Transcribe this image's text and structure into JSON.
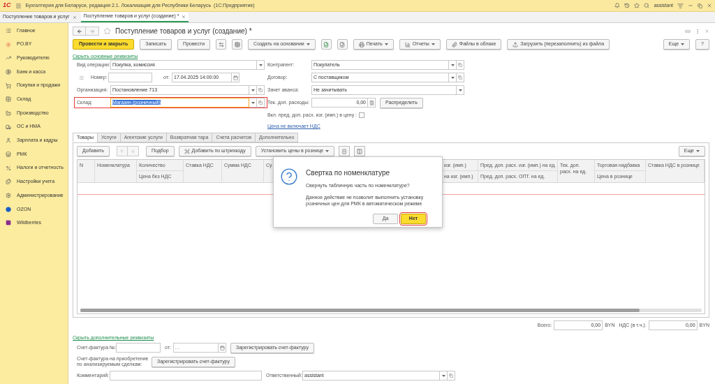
{
  "app_bar": {
    "logo": "1С",
    "title": "Бухгалтерия для Беларуси, редакция 2.1. Локализация для Республики Беларусь  (1С:Предприятие)",
    "user": "assistant"
  },
  "open_tabs": [
    {
      "label": "Поступление товаров и услуг",
      "selected": false
    },
    {
      "label": "Поступление товаров и услуг (создание) *",
      "selected": true
    }
  ],
  "sidebar": {
    "items": [
      "Главное",
      "PO.BY",
      "Руководителю",
      "Банк и касса",
      "Покупки и продажи",
      "Склад",
      "Производство",
      "ОС и НМА",
      "Зарплата и кадры",
      "РМК",
      "Налоги и отчетность",
      "Настройки учета",
      "Администрирование",
      "OZON",
      "Wildberries"
    ]
  },
  "form": {
    "title": "Поступление товаров и услуг (создание) *",
    "toolbar": [
      {
        "kind": "primary",
        "label": "Провести и закрыть"
      },
      {
        "kind": "button",
        "label": "Записать"
      },
      {
        "kind": "button",
        "label": "Провести"
      },
      {
        "kind": "icon"
      },
      {
        "kind": "icon"
      },
      {
        "kind": "menu",
        "label": "Создать на основании"
      },
      {
        "kind": "icon"
      },
      {
        "kind": "icon"
      },
      {
        "kind": "menu",
        "label": "Печать"
      },
      {
        "kind": "menu",
        "label": "Отчеты"
      },
      {
        "kind": "button",
        "label": "Файлы в облаке"
      },
      {
        "kind": "button",
        "label": "Загрузить (перезаполнить) из файла"
      }
    ],
    "toolbar_right": [
      {
        "kind": "menu",
        "label": "Еще"
      },
      {
        "kind": "button",
        "label": "?"
      }
    ],
    "hide_main_link": "Скрыть основные реквизиты",
    "operation": {
      "label": "Вид операции:",
      "value": "Покупка, комиссия",
      "dropdown": true,
      "open": false
    },
    "number": {
      "label": "Номер:"
    },
    "date": {
      "label": "от:",
      "value": "17.04.2025 14:00:00"
    },
    "organization": {
      "label": "Организация:",
      "value": "Постановление 713",
      "dropdown": true,
      "open": true
    },
    "warehouse": {
      "label": "Склад:",
      "value": "Магазин (розничный)",
      "dropdown": true,
      "open": true,
      "highlighted": true
    },
    "counterparty": {
      "label": "Контрагент:",
      "value": "Покупатель",
      "dropdown": true,
      "open": true
    },
    "contract": {
      "label": "Договор:",
      "value": "С поставщиком",
      "dropdown": true,
      "open": true
    },
    "advance": {
      "label": "Зачет аванса:",
      "value": "Не зачитывать",
      "dropdown": true,
      "open": false
    },
    "extra_costs": {
      "label": "Тек. доп. расходы:",
      "value": "0,00",
      "button": "Распределить"
    },
    "include_costs": {
      "label": "Вкл. пред. доп. расх. изг. (имп.) в цену :",
      "checked": false
    },
    "vat_link": "Цена не включает НДС"
  },
  "tabs": [
    {
      "label": "Товары",
      "selected": true
    },
    {
      "label": "Услуги",
      "selected": false
    },
    {
      "label": "Агентские услуги",
      "selected": false
    },
    {
      "label": "Возвратная тара",
      "selected": false
    },
    {
      "label": "Счета расчетов",
      "selected": false
    },
    {
      "label": "Дополнительно",
      "selected": false
    }
  ],
  "table_toolbar": [
    {
      "kind": "button",
      "label": "Добавить"
    },
    {
      "kind": "arrows"
    },
    {
      "kind": "button",
      "label": "Подбор"
    },
    {
      "kind": "barcode",
      "label": "Добавить по штрихкоду"
    },
    {
      "kind": "menu",
      "label": "Установить цены в рознице"
    },
    {
      "kind": "icon"
    },
    {
      "kind": "icon"
    }
  ],
  "table_more": "Еще",
  "table": {
    "columns": [
      {
        "title": "N"
      },
      {
        "title": "Номенклатура"
      },
      {
        "title": "Количество",
        "subtitle": "Цена без НДС"
      },
      {
        "title": "Ставка НДС"
      },
      {
        "title": "Сумма НДС"
      },
      {
        "title": "Су"
      },
      {
        "title": "изг. (имп.)",
        "subtitle": "на изг. (имп.)"
      },
      {
        "title": "Пред. доп. расх. изг. (имп.) на ед.",
        "subtitle": "Пред. доп. расх. ОПТ. на ед."
      },
      {
        "title": "Тек. доп. расх. на ед."
      },
      {
        "title": "Торговая надбавка",
        "subtitle": "Цена в рознице"
      },
      {
        "title": "Ставка НДС в рознице"
      }
    ]
  },
  "totals": [
    {
      "label": "Всего:",
      "value": "0,00",
      "currency": "BYN"
    },
    {
      "label": "НДС (в т.ч.):",
      "value": "0,00",
      "currency": "BYN"
    }
  ],
  "extra": {
    "hide_link": "Скрыть дополнительные реквизиты",
    "invoice": {
      "label": "Счет-фактура №:",
      "date_label": "от:",
      "date_value": ". .",
      "button": "Зарегистрировать счет-фактуру"
    },
    "purchase_invoice": {
      "label": "Счет-фактура на приобретение по анализируемым сделкам:",
      "button": "Зарегистрировать счет-фактуру"
    },
    "comment": {
      "label": "Комментарий:"
    },
    "responsible": {
      "label": "Ответственный:",
      "value": "assistant",
      "dropdown": true,
      "open": true
    }
  },
  "dialog": {
    "title": "Свертка по номенклатуре",
    "question": "Свернуть табличную часть по номенклатуре?",
    "note": "Данное действие не позволит выполнить установку розничных цен для РМК в автоматическом режиме",
    "buttons": [
      {
        "label": "Да",
        "default": false
      },
      {
        "label": "Нет",
        "default": true
      }
    ]
  }
}
